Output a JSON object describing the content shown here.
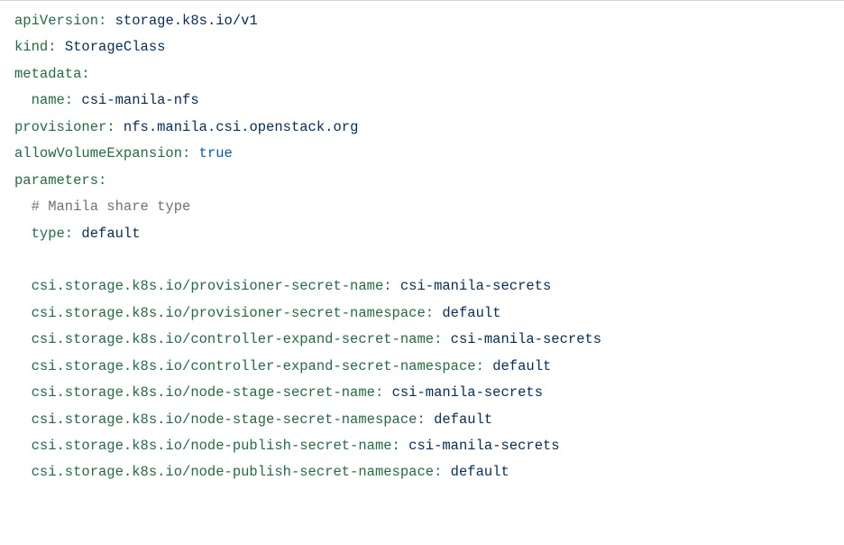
{
  "yaml": {
    "line1_key": "apiVersion:",
    "line1_val": " storage.k8s.io/v1",
    "line2_key": "kind:",
    "line2_val": " StorageClass",
    "line3_key": "metadata:",
    "line4_key": "name:",
    "line4_val": " csi-manila-nfs",
    "line5_key": "provisioner:",
    "line5_val": " nfs.manila.csi.openstack.org",
    "line6_key": "allowVolumeExpansion:",
    "line6_val": " true",
    "line7_key": "parameters:",
    "line8_comment": "# Manila share type",
    "line9_key": "type:",
    "line9_val": " default",
    "line11_key": "csi.storage.k8s.io/provisioner-secret-name:",
    "line11_val": " csi-manila-secrets",
    "line12_key": "csi.storage.k8s.io/provisioner-secret-namespace:",
    "line12_val": " default",
    "line13_key": "csi.storage.k8s.io/controller-expand-secret-name:",
    "line13_val": " csi-manila-secrets",
    "line14_key": "csi.storage.k8s.io/controller-expand-secret-namespace:",
    "line14_val": " default",
    "line15_key": "csi.storage.k8s.io/node-stage-secret-name:",
    "line15_val": " csi-manila-secrets",
    "line16_key": "csi.storage.k8s.io/node-stage-secret-namespace:",
    "line16_val": " default",
    "line17_key": "csi.storage.k8s.io/node-publish-secret-name:",
    "line17_val": " csi-manila-secrets",
    "line18_key": "csi.storage.k8s.io/node-publish-secret-namespace:",
    "line18_val": " default"
  }
}
